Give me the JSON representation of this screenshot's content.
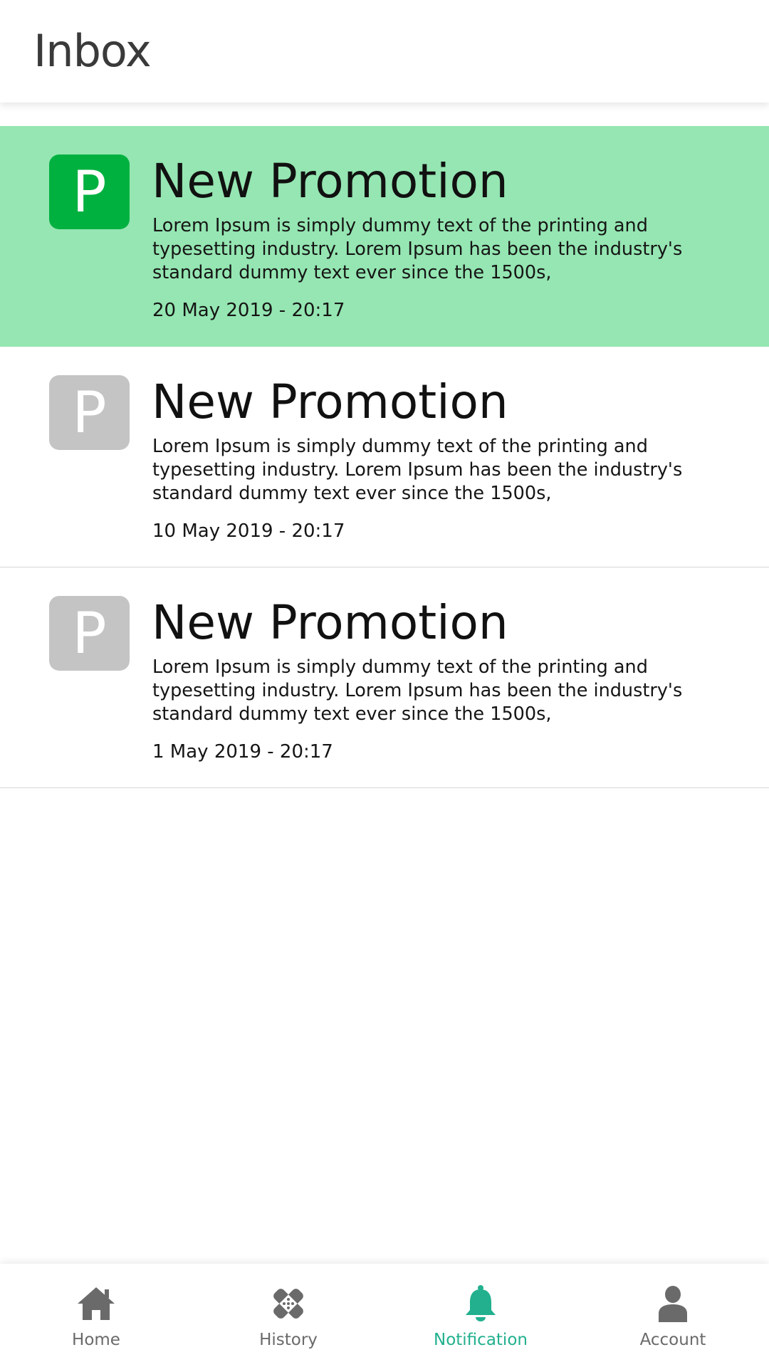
{
  "header": {
    "title": "Inbox"
  },
  "notifications": [
    {
      "avatar_letter": "P",
      "title": "New Promotion",
      "body": "Lorem Ipsum is simply dummy text of the printing and typesetting industry. Lorem Ipsum has been the industry's standard dummy text ever since the 1500s,",
      "date": "20 May 2019 - 20:17",
      "unread": true
    },
    {
      "avatar_letter": "P",
      "title": "New Promotion",
      "body": "Lorem Ipsum is simply dummy text of the printing and typesetting industry. Lorem Ipsum has been the industry's standard dummy text ever since the 1500s,",
      "date": "10 May 2019 - 20:17",
      "unread": false
    },
    {
      "avatar_letter": "P",
      "title": "New Promotion",
      "body": "Lorem Ipsum is simply dummy text of the printing and typesetting industry. Lorem Ipsum has been the industry's standard dummy text ever since the 1500s,",
      "date": "1 May 2019 - 20:17",
      "unread": false
    }
  ],
  "bottom_nav": {
    "items": [
      {
        "label": "Home",
        "icon": "home-icon",
        "active": false
      },
      {
        "label": "History",
        "icon": "bandage-icon",
        "active": false
      },
      {
        "label": "Notification",
        "icon": "bell-icon",
        "active": true
      },
      {
        "label": "Account",
        "icon": "person-icon",
        "active": false
      }
    ]
  },
  "colors": {
    "unread_background": "#95e6b2",
    "unread_avatar": "#00b140",
    "read_avatar": "#c4c4c4",
    "active_nav": "#22b08e",
    "inactive_nav": "#6a6a6a"
  }
}
